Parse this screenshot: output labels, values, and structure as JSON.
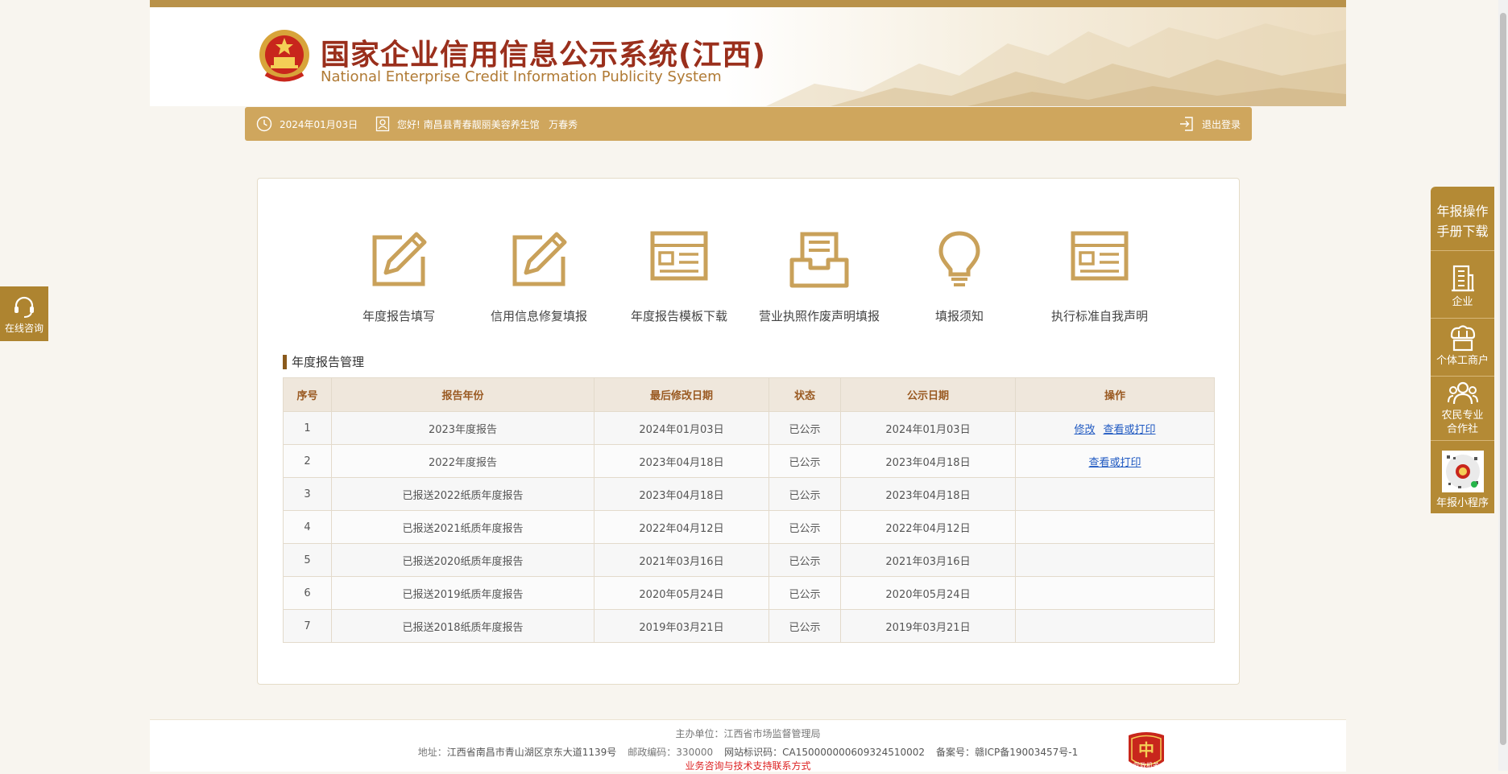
{
  "header": {
    "title_cn": "国家企业信用信息公示系统(江西)",
    "title_en": "National Enterprise Credit Information Publicity System"
  },
  "infobar": {
    "date": "2024年01月03日",
    "greeting": "您好! 南昌县青春靓丽美容养生馆   万春秀",
    "logout": "退出登录"
  },
  "functions": [
    {
      "label": "年度报告填写",
      "icon": "edit-icon"
    },
    {
      "label": "信用信息修复填报",
      "icon": "edit-icon"
    },
    {
      "label": "年度报告模板下载",
      "icon": "template-icon"
    },
    {
      "label": "营业执照作废声明填报",
      "icon": "inbox-icon"
    },
    {
      "label": "填报须知",
      "icon": "lightbulb-icon"
    },
    {
      "label": "执行标准自我声明",
      "icon": "template-icon"
    }
  ],
  "section_title": "年度报告管理",
  "table": {
    "headers": [
      "序号",
      "报告年份",
      "最后修改日期",
      "状态",
      "公示日期",
      "操作"
    ],
    "rows": [
      {
        "no": "1",
        "year": "2023年度报告",
        "modified": "2024年01月03日",
        "status": "已公示",
        "published": "2024年01月03日",
        "actions": [
          "修改",
          "查看或打印"
        ]
      },
      {
        "no": "2",
        "year": "2022年度报告",
        "modified": "2023年04月18日",
        "status": "已公示",
        "published": "2023年04月18日",
        "actions": [
          "查看或打印"
        ]
      },
      {
        "no": "3",
        "year": "已报送2022纸质年度报告",
        "modified": "2023年04月18日",
        "status": "已公示",
        "published": "2023年04月18日",
        "actions": []
      },
      {
        "no": "4",
        "year": "已报送2021纸质年度报告",
        "modified": "2022年04月12日",
        "status": "已公示",
        "published": "2022年04月12日",
        "actions": []
      },
      {
        "no": "5",
        "year": "已报送2020纸质年度报告",
        "modified": "2021年03月16日",
        "status": "已公示",
        "published": "2021年03月16日",
        "actions": []
      },
      {
        "no": "6",
        "year": "已报送2019纸质年度报告",
        "modified": "2020年05月24日",
        "status": "已公示",
        "published": "2020年05月24日",
        "actions": []
      },
      {
        "no": "7",
        "year": "已报送2018纸质年度报告",
        "modified": "2019年03月21日",
        "status": "已公示",
        "published": "2019年03月21日",
        "actions": []
      }
    ]
  },
  "footer": {
    "sponsor": "主办单位：江西省市场监督管理局",
    "address_label": "地址：",
    "address": "江西省南昌市青山湖区京东大道1139号",
    "postcode_label": "邮政编码：",
    "postcode": "330000",
    "site_id_label": "网站标识码：",
    "site_id": "CA150000000609324510002",
    "icp_label": "备案号：",
    "icp": "赣ICP备19003457号-1",
    "contact": "业务咨询与技术支持联系方式",
    "badge_text": "党政机关"
  },
  "left_float": {
    "label": "在线咨询"
  },
  "right_float": {
    "manual": "年报操作手册下载",
    "items": [
      "企业",
      "个体工商户",
      "农民专业合作社",
      "年报小程序"
    ]
  },
  "colors": {
    "gold": "#cfa65d",
    "dark_gold": "#b48a35",
    "title_red": "#9a2f1c",
    "link_blue": "#1f59c2"
  }
}
